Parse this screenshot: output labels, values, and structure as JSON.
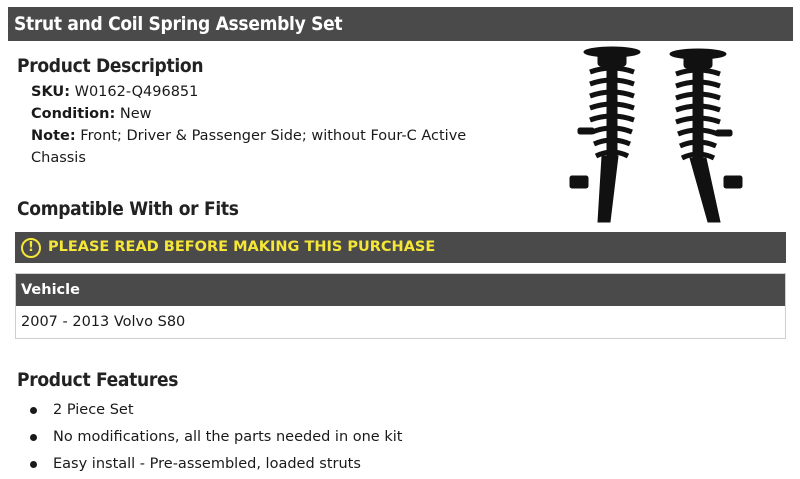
{
  "header": {
    "title": "Strut and Coil Spring Assembly Set"
  },
  "description": {
    "heading": "Product Description",
    "sku_label": "SKU:",
    "sku_value": "W0162-Q496851",
    "condition_label": "Condition:",
    "condition_value": "New",
    "note_label": "Note:",
    "note_value": "Front; Driver & Passenger Side; without Four-C Active Chassis"
  },
  "compatibility": {
    "heading": "Compatible With or Fits",
    "alert_text": "PLEASE READ BEFORE MAKING THIS PURCHASE",
    "alert_icon": "exclamation-circle-icon",
    "table_header": "Vehicle",
    "rows": [
      "2007 - 2013 Volvo S80"
    ]
  },
  "features": {
    "heading": "Product Features",
    "items": [
      "2 Piece Set",
      "No modifications, all the parts needed in one kit",
      "Easy install - Pre-assembled, loaded struts"
    ]
  },
  "colors": {
    "bar": "#4a4a4a",
    "accent": "#f5e637"
  }
}
